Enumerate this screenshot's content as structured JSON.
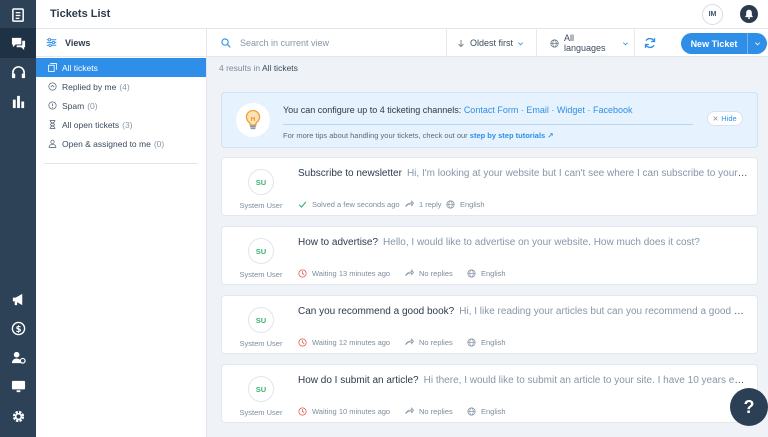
{
  "header": {
    "title": "Tickets List",
    "avatar_initials": "IM"
  },
  "views": {
    "title": "Views",
    "items": [
      {
        "label": "All tickets",
        "count": ""
      },
      {
        "label": "Replied by me",
        "count": "(4)"
      },
      {
        "label": "Spam",
        "count": "(0)"
      },
      {
        "label": "All open tickets",
        "count": "(3)"
      },
      {
        "label": "Open & assigned to me",
        "count": "(0)"
      }
    ]
  },
  "toolbar": {
    "search_placeholder": "Search in current view",
    "sort_label": "Oldest first",
    "language_label": "All languages",
    "new_ticket_label": "New Ticket"
  },
  "results": {
    "count_text": "4 results in",
    "view_name": "All tickets"
  },
  "tip": {
    "text": "You can configure up to 4 ticketing channels:",
    "channels": [
      "Contact Form",
      "Email",
      "Widget",
      "Facebook"
    ],
    "sub_text": "For more tips about handling your tickets, check out our",
    "sub_link": "step by step tutorials ↗",
    "hide_label": "Hide"
  },
  "tickets": [
    {
      "initials": "SU",
      "author": "System User",
      "subject": "Subscribe to newsletter",
      "preview": "Hi, I'm looking at your website but I can't see where I can subscribe to your newsletter.",
      "status": "Solved a few seconds ago",
      "status_kind": "solved",
      "replies": "1 reply",
      "language": "English"
    },
    {
      "initials": "SU",
      "author": "System User",
      "subject": "How to advertise?",
      "preview": "Hello, I would like to advertise on your website. How much does it cost?",
      "status": "Waiting 13 minutes ago",
      "status_kind": "waiting",
      "replies": "No replies",
      "language": "English"
    },
    {
      "initials": "SU",
      "author": "System User",
      "subject": "Can you recommend a good book?",
      "preview": "Hi, I like reading your articles but can you recommend a good customer service book?",
      "status": "Waiting 12 minutes ago",
      "status_kind": "waiting",
      "replies": "No replies",
      "language": "English"
    },
    {
      "initials": "SU",
      "author": "System User",
      "subject": "How do I submit an article?",
      "preview": "Hi there, I would like to submit an article to your site. I have 10 years experience.",
      "status": "Waiting 10 minutes ago",
      "status_kind": "waiting",
      "replies": "No replies",
      "language": "English"
    }
  ],
  "help_label": "?",
  "colors": {
    "accent": "#2f8fe8",
    "rail": "#2d4157",
    "solved": "#3cb371",
    "waiting": "#e05a4f"
  },
  "icons": {
    "rail": [
      "tickets-icon",
      "chat-icon",
      "headset-icon",
      "reports-icon",
      "megaphone-icon",
      "dollar-icon",
      "agents-icon",
      "monitor-icon",
      "settings-gear-icon"
    ]
  }
}
